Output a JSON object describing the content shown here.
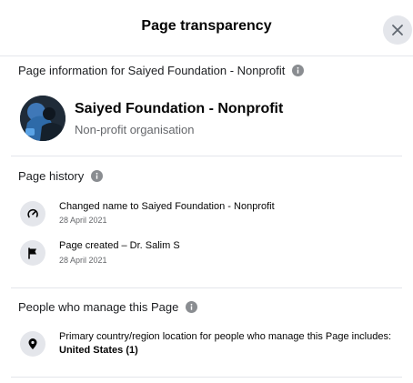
{
  "dialog": {
    "title": "Page transparency",
    "close_label": "close"
  },
  "page_info": {
    "heading": "Page information for Saiyed Foundation - Nonprofit",
    "name": "Saiyed Foundation - Nonprofit",
    "category": "Non-profit organisation"
  },
  "page_history": {
    "heading": "Page history",
    "items": [
      {
        "icon": "name-change-icon",
        "text": "Changed name to Saiyed Foundation - Nonprofit",
        "date": "28 April 2021"
      },
      {
        "icon": "flag-icon",
        "text": "Page created – Dr. Salim S",
        "date": "28 April 2021"
      }
    ]
  },
  "managers": {
    "heading": "People who manage this Page",
    "description": "Primary country/region location for people who manage this Page includes:",
    "country": "United States (1)"
  },
  "colors": {
    "divider": "#e4e6eb",
    "icon_bg": "#e4e6eb",
    "secondary_text": "#65676b",
    "primary_text": "#050505"
  }
}
